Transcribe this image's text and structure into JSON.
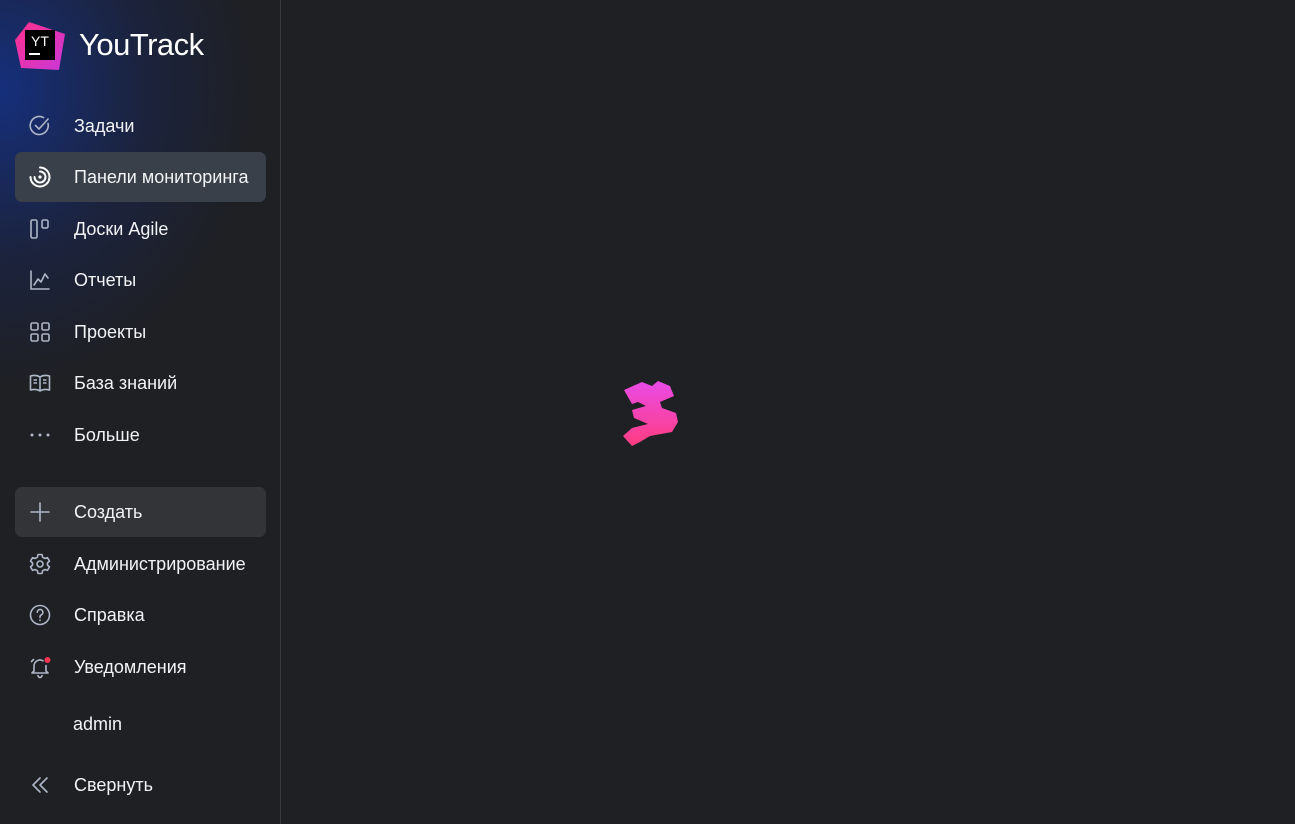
{
  "app": {
    "name": "YouTrack",
    "logo_letters": "YT"
  },
  "sidebar": {
    "items": [
      {
        "label": "Задачи",
        "icon": "check-circle-icon"
      },
      {
        "label": "Панели мониторинга",
        "icon": "dashboard-icon",
        "active": true
      },
      {
        "label": "Доски Agile",
        "icon": "agile-board-icon"
      },
      {
        "label": "Отчеты",
        "icon": "reports-chart-icon"
      },
      {
        "label": "Проекты",
        "icon": "projects-grid-icon"
      },
      {
        "label": "База знаний",
        "icon": "knowledge-base-book-icon"
      },
      {
        "label": "Больше",
        "icon": "more-dots-icon"
      }
    ],
    "actions": [
      {
        "label": "Создать",
        "icon": "plus-icon"
      },
      {
        "label": "Администрирование",
        "icon": "gear-icon"
      },
      {
        "label": "Справка",
        "icon": "help-icon"
      },
      {
        "label": "Уведомления",
        "icon": "bell-icon",
        "has_unread": true
      }
    ],
    "user": {
      "name": "admin"
    },
    "collapse": {
      "label": "Свернуть",
      "icon": "double-chevron-left-icon"
    }
  },
  "colors": {
    "background": "#1f2023",
    "accent_pink": "#ff3e9a",
    "active_item": "#3a404a",
    "notification_dot": "#ff3353"
  },
  "main": {
    "state": "loading",
    "loader_icon": "youtrack-loader-icon"
  }
}
